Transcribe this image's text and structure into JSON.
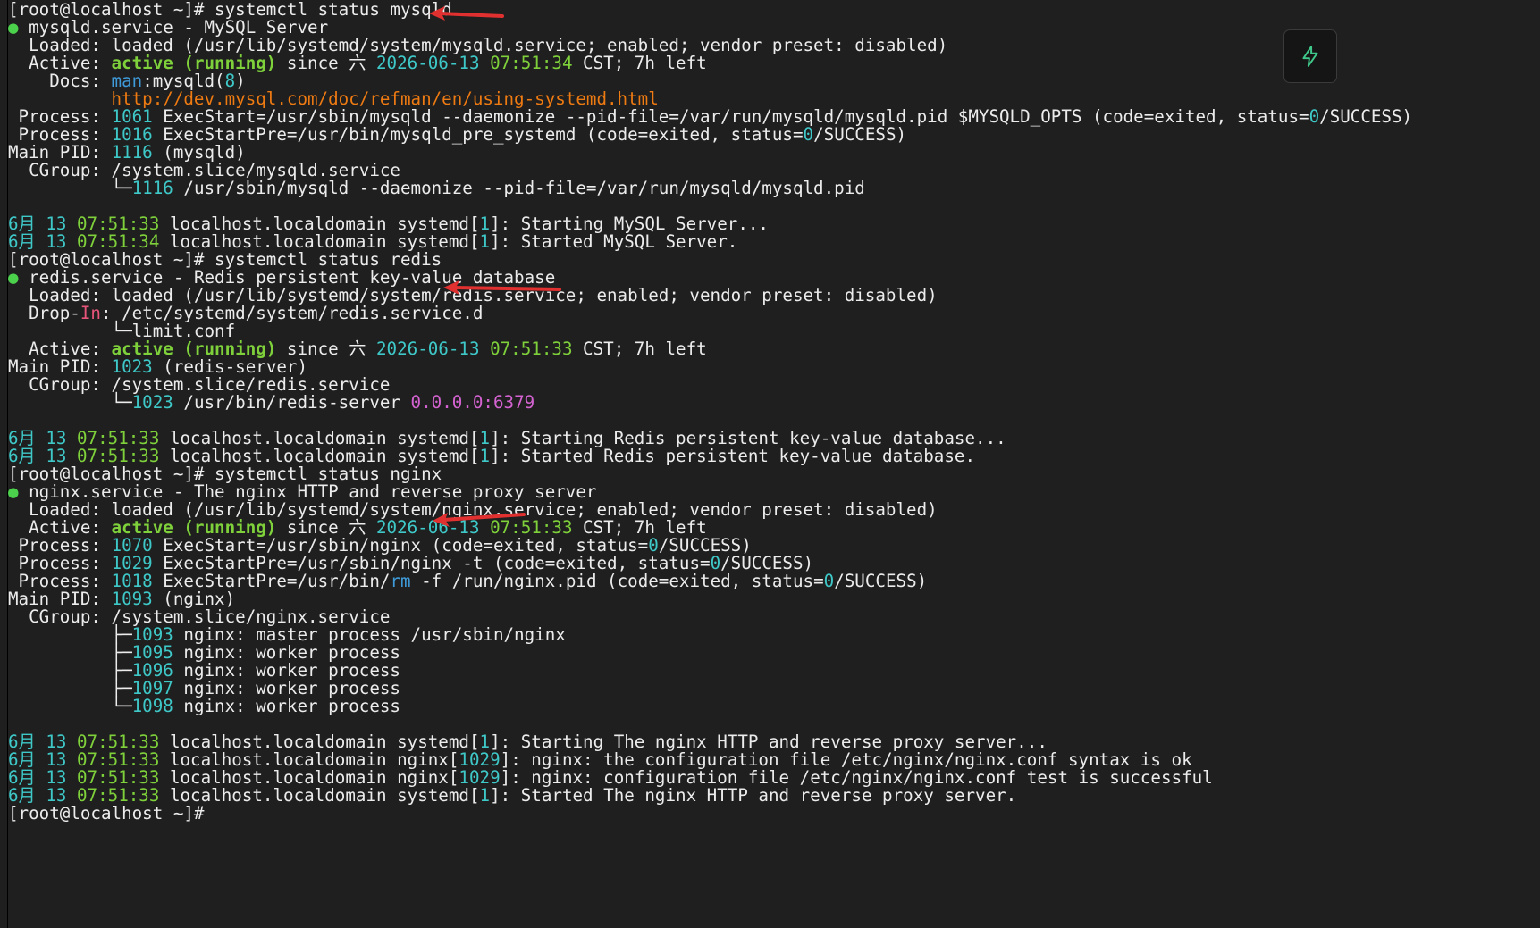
{
  "prompt": "[root@localhost ~]# ",
  "cmd_mysql": "systemctl status mysqld",
  "cmd_redis": "systemctl status redis",
  "cmd_nginx": "systemctl status nginx",
  "bullet": "●",
  "mysql": {
    "head": " mysqld.service - MySQL Server",
    "loaded": "  Loaded: loaded (/usr/lib/systemd/system/mysqld.service; enabled; vendor preset: disabled)",
    "active_pre": "  Active: ",
    "active_state": "active (running)",
    "active_since": " since 六 ",
    "active_date": "2026-06-13",
    "active_time": "07:51:34",
    "active_post": " CST; 7h left",
    "docs_pre": "    Docs: ",
    "docs_man": "man",
    "docs_mid": ":mysqld(",
    "docs_num": "8",
    "docs_end": ")",
    "docs_url": "          http://dev.mysql.com/doc/refman/en/using-systemd.html",
    "proc1_pre": " Process: ",
    "proc1_pid": "1061",
    "proc1_txt": " ExecStart=/usr/sbin/mysqld --daemonize --pid-file=/var/run/mysqld/mysqld.pid $MYSQLD_OPTS (code=exited, status=",
    "proc1_zero": "0",
    "proc1_end": "/SUCCESS)",
    "proc2_pre": " Process: ",
    "proc2_pid": "1016",
    "proc2_txt": " ExecStartPre=/usr/bin/mysqld_pre_systemd (code=exited, status=",
    "proc2_zero": "0",
    "proc2_end": "/SUCCESS)",
    "mainpid_pre": "Main PID: ",
    "mainpid": "1116",
    "mainpid_end": " (mysqld)",
    "cgroup": "  CGroup: /system.slice/mysqld.service",
    "tree_pre": "          └─",
    "tree_pid": "1116",
    "tree_txt": " /usr/sbin/mysqld --daemonize --pid-file=/var/run/mysqld/mysqld.pid",
    "log1_txt": " localhost.localdomain systemd[",
    "log1_end": "]: Starting MySQL Server...",
    "log2_end": "]: Started MySQL Server.",
    "log_time1": "07:51:33",
    "log_time2": "07:51:34"
  },
  "redis": {
    "head": " redis.service - Redis persistent key-value database",
    "loaded": "  Loaded: loaded (/usr/lib/systemd/system/redis.service; enabled; vendor preset: disabled)",
    "dropin_pre": "  Drop-",
    "dropin_in": "In",
    "dropin_end": ": /etc/systemd/system/redis.service.d",
    "limit": "          └─limit.conf",
    "active_time": "07:51:33",
    "mainpid": "1023",
    "mainpid_end": " (redis-server)",
    "cgroup": "  CGroup: /system.slice/redis.service",
    "tree_pid": "1023",
    "tree_txt": " /usr/bin/redis-server ",
    "tree_addr": "0.0.0.0:6379",
    "log1_end": "]: Starting Redis persistent key-value database...",
    "log2_end": "]: Started Redis persistent key-value database."
  },
  "nginx": {
    "head": " nginx.service - The nginx HTTP and reverse proxy server",
    "loaded": "  Loaded: loaded (/usr/lib/systemd/system/nginx.service; enabled; vendor preset: disabled)",
    "active_time": "07:51:33",
    "proc1_pid": "1070",
    "proc1_txt": " ExecStart=/usr/sbin/nginx (code=exited, status=",
    "proc2_pid": "1029",
    "proc2_txt": " ExecStartPre=/usr/sbin/nginx -t (code=exited, status=",
    "proc3_pid": "1018",
    "proc3_txt_a": " ExecStartPre=/usr/bin/",
    "proc3_rm": "rm",
    "proc3_txt_b": " -f /run/nginx.pid (code=exited, status=",
    "mainpid": "1093",
    "mainpid_end": " (nginx)",
    "cgroup": "  CGroup: /system.slice/nginx.service",
    "tree_mid": "          ├─",
    "tree_last": "          └─",
    "tree": [
      {
        "pid": "1093",
        "txt": " nginx: master process /usr/sbin/nginx"
      },
      {
        "pid": "1095",
        "txt": " nginx: worker process"
      },
      {
        "pid": "1096",
        "txt": " nginx: worker process"
      },
      {
        "pid": "1097",
        "txt": " nginx: worker process"
      },
      {
        "pid": "1098",
        "txt": " nginx: worker process"
      }
    ],
    "log1_end": "]: Starting The nginx HTTP and reverse proxy server...",
    "log2_txt": " localhost.localdomain nginx[",
    "log2_pid": "1029",
    "log2_end": "]: nginx: the configuration file /etc/nginx/nginx.conf syntax is ok",
    "log3_end": "]: nginx: configuration file /etc/nginx/nginx.conf test is successful",
    "log4_end": "]: Started The nginx HTTP and reverse proxy server."
  },
  "common": {
    "month": "6月",
    "day": "13",
    "one": "1",
    "proc_pre": " Process: ",
    "active_pre": "  Active: ",
    "active_state": "active (running)",
    "since": " since 六 ",
    "date": "2026-06-13",
    "left": " CST; 7h left",
    "mainpid_pre": "Main PID: ",
    "zero": "0",
    "success": "/SUCCESS)",
    "localhost": " localhost.localdomain systemd["
  },
  "colors": {
    "background": "#1f1f1f",
    "text": "#ececec",
    "green": "#7fd13b",
    "cyan": "#3fc8c8",
    "blue": "#3e9ad8",
    "orange": "#ee7a12",
    "magenta": "#d463d1",
    "arrow": "#e03030"
  },
  "icons": {
    "arrow": "red-annotation-arrow",
    "bolt": "lightning-bolt-icon"
  }
}
